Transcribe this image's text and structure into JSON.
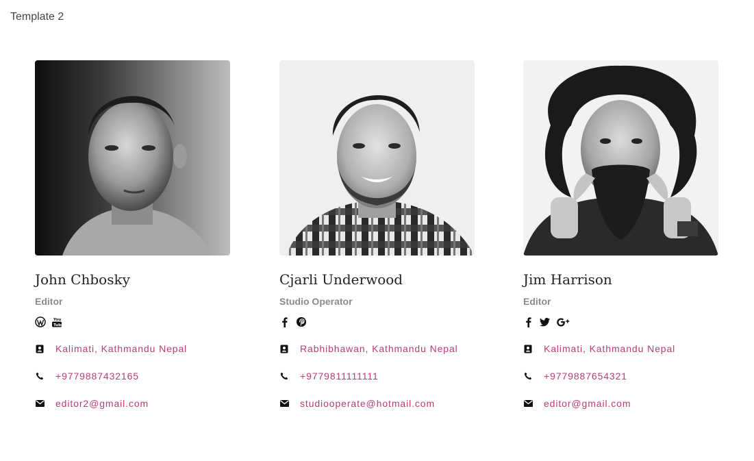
{
  "page": {
    "template_label": "Template 2"
  },
  "colors": {
    "link": "#b83c74",
    "name": "#222222",
    "role": "#8a8a8a",
    "icon": "#111111"
  },
  "members": [
    {
      "name": "John Chbosky",
      "role": "Editor",
      "socials": [
        "wordpress-icon",
        "youtube-icon"
      ],
      "address": "Kalimati, Kathmandu Nepal",
      "phone": "+9779887432165",
      "email": "editor2@gmail.com"
    },
    {
      "name": "Cjarli Underwood",
      "role": "Studio Operator",
      "socials": [
        "facebook-icon",
        "pinterest-icon"
      ],
      "address": "Rabhibhawan, Kathmandu Nepal",
      "phone": "+9779811111111",
      "email": "studiooperate@hotmail.com"
    },
    {
      "name": "Jim Harrison",
      "role": "Editor",
      "socials": [
        "facebook-icon",
        "twitter-icon",
        "google-plus-icon"
      ],
      "address": "Kalimati, Kathmandu Nepal",
      "phone": "+9779887654321",
      "email": "editor@gmail.com"
    }
  ]
}
